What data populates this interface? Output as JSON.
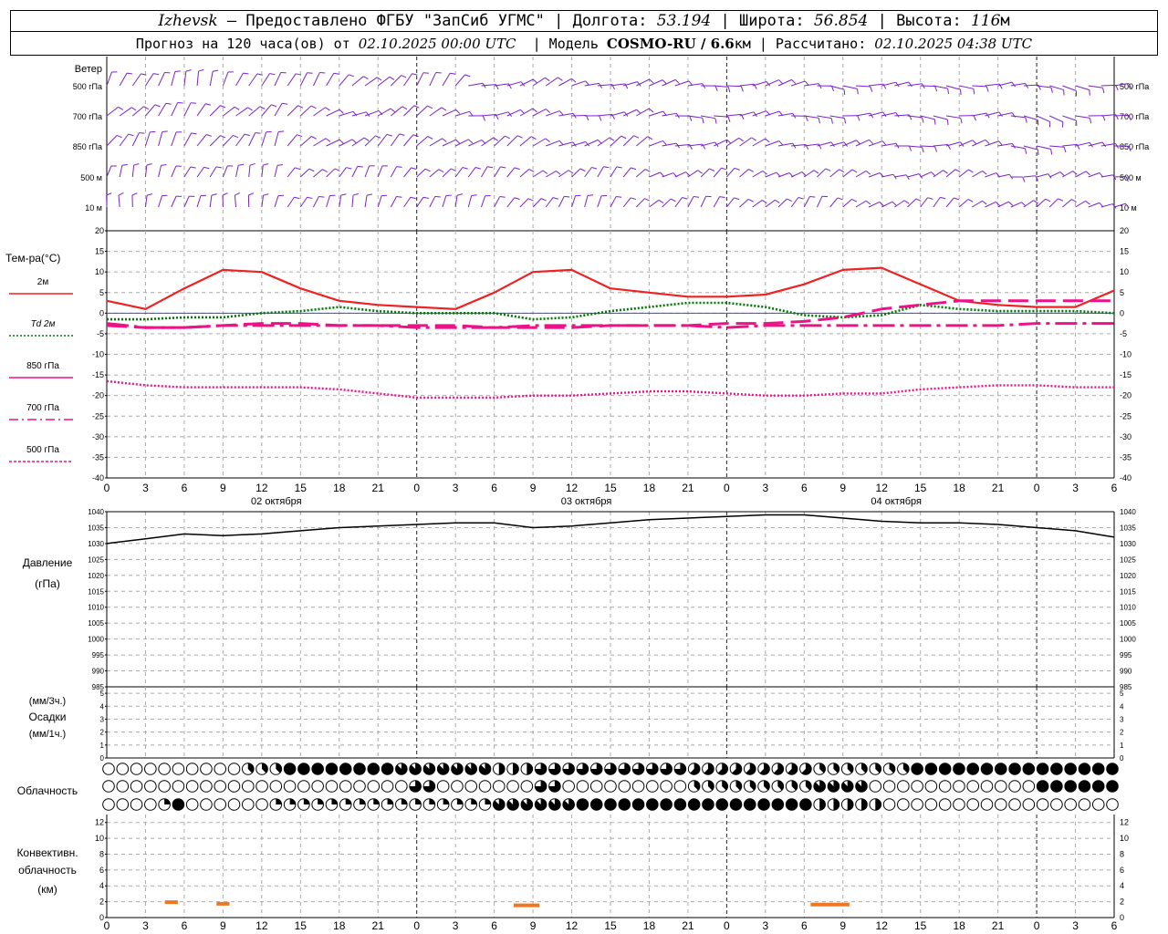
{
  "header": {
    "city": "Izhevsk",
    "provider": "– Предоставлено ФГБУ \"ЗапСиб УГМС\"",
    "lon_label": "Долгота:",
    "lon_value": "53.194",
    "lat_label": "Широта:",
    "lat_value": "56.854",
    "alt_label": "Высота:",
    "alt_value": "116",
    "alt_unit": "м",
    "forecast_label": "Прогноз на 120 часа(ов) от",
    "forecast_start": "02.10.2025 00:00 UTC",
    "model_label": "Модель",
    "model_name": "COSMO-RU / 6.6",
    "model_unit": "км",
    "computed_label": "Рассчитано:",
    "computed_value": "02.10.2025 04:38 UTC"
  },
  "colors": {
    "t2m": "#ee2222",
    "td2m": "#007700",
    "t850": "#ee1188",
    "t700": "#ee1188",
    "t500": "#ee1188",
    "barb": "#7a22cc",
    "pressure": "#000000",
    "convective": "#ee7722",
    "grid": "#aaaaaa"
  },
  "wind_panel": {
    "title": "Ветер",
    "levels": [
      "500 гПа",
      "700 гПа",
      "850 гПа",
      "500 м",
      "10 м"
    ]
  },
  "temp_panel": {
    "title": "Тем-ра(°С)",
    "legend": [
      "2м",
      "Td  2м",
      "850 гПа",
      "700 гПа",
      "500 гПа"
    ],
    "y_ticks": [
      "20",
      "15",
      "10",
      "5",
      "0",
      "-5",
      "-10",
      "-15",
      "-20",
      "-25",
      "-30",
      "-35",
      "-40"
    ]
  },
  "pressure_panel": {
    "title": "Давление",
    "unit": "(гПа)",
    "y_ticks": [
      "1040",
      "1035",
      "1030",
      "1025",
      "1020",
      "1015",
      "1010",
      "1005",
      "1000",
      "995",
      "990",
      "985"
    ]
  },
  "precip_panel": {
    "unit_top": "(мм/3ч.)",
    "title": "Осадки",
    "unit_bottom": "(мм/1ч.)",
    "y_ticks": [
      "5",
      "4",
      "3",
      "2",
      "1",
      "0"
    ]
  },
  "cloud_panel": {
    "title": "Облачность"
  },
  "conv_panel": {
    "title": "Конвективн.",
    "title2": "облачность",
    "unit": "(км)",
    "y_ticks": [
      "12",
      "10",
      "8",
      "6",
      "4",
      "2",
      "0"
    ]
  },
  "x_axis": {
    "hour_labels": [
      "0",
      "3",
      "6",
      "9",
      "12",
      "15",
      "18",
      "21",
      "0",
      "3",
      "6",
      "9",
      "12",
      "15",
      "18",
      "21",
      "0",
      "3",
      "6",
      "9",
      "12",
      "15",
      "18",
      "21",
      "0",
      "3",
      "6"
    ],
    "dates": [
      "02 октября",
      "03 октября",
      "04 октября"
    ]
  },
  "chart_data": {
    "type": "line",
    "x_hours": [
      0,
      3,
      6,
      9,
      12,
      15,
      18,
      21,
      24,
      27,
      30,
      33,
      36,
      39,
      42,
      45,
      48,
      51,
      54,
      57,
      60,
      63,
      66,
      69,
      72,
      75,
      78
    ],
    "x_unit": "hours from 02.10.2025 00:00 UTC",
    "series": [
      {
        "name": "2м",
        "values": [
          3,
          1,
          6,
          10.5,
          10,
          6,
          3,
          2,
          1.5,
          1,
          5,
          10,
          10.5,
          6,
          5,
          4,
          4,
          4.5,
          7,
          10.5,
          11,
          7,
          3,
          2,
          1.5,
          1.5,
          5.5
        ]
      },
      {
        "name": "Td  2м",
        "values": [
          -1.5,
          -1.5,
          -1,
          -1,
          0,
          0.5,
          1.5,
          0.5,
          0,
          0,
          0,
          -1.5,
          -1,
          0.5,
          1.5,
          2.5,
          2.5,
          1.5,
          -0.5,
          -1,
          -0.5,
          2,
          1,
          0.5,
          0.5,
          0.5,
          0
        ]
      },
      {
        "name": "850 гПа",
        "values": [
          -3,
          -3.5,
          -3.5,
          -3,
          -2.5,
          -2.5,
          -3,
          -3,
          -3,
          -3,
          -3.5,
          -3.5,
          -3.5,
          -3,
          -3,
          -3,
          -2.5,
          -2.5,
          -2,
          -1,
          1,
          2,
          3,
          3,
          3,
          3,
          3
        ]
      },
      {
        "name": "700 гПа",
        "values": [
          -2.5,
          -3.5,
          -3.5,
          -3,
          -3,
          -3,
          -3,
          -3,
          -3.5,
          -3.5,
          -3.5,
          -3,
          -3,
          -3,
          -3,
          -3,
          -3.5,
          -3,
          -3,
          -3,
          -3,
          -3,
          -3,
          -3,
          -2.5,
          -2.5,
          -2.5
        ]
      },
      {
        "name": "500 гПа",
        "values": [
          -16.5,
          -17.5,
          -18,
          -18,
          -18,
          -18,
          -18.5,
          -19.5,
          -20.5,
          -20.5,
          -20.5,
          -20,
          -20,
          -19.5,
          -19,
          -19,
          -19.5,
          -20,
          -20,
          -19.5,
          -19.5,
          -18.5,
          -18,
          -17.5,
          -17.5,
          -18,
          -18
        ]
      }
    ],
    "pressure": {
      "values": [
        1030,
        1031.5,
        1033,
        1032.5,
        1033,
        1034,
        1035,
        1035.5,
        1036,
        1036.5,
        1036.5,
        1035,
        1035.5,
        1036.5,
        1037.5,
        1038,
        1038.5,
        1039,
        1039,
        1038,
        1037,
        1036.5,
        1036.5,
        1036,
        1035,
        1034,
        1032
      ]
    },
    "precipitation": {
      "values": [
        0,
        0,
        0,
        0,
        0,
        0,
        0,
        0,
        0,
        0,
        0,
        0,
        0,
        0,
        0,
        0,
        0,
        0,
        0,
        0,
        0,
        0,
        0,
        0,
        0,
        0,
        0
      ]
    },
    "convective_cloud": [
      {
        "from_hour": 4.5,
        "to_hour": 5.5,
        "km": 2
      },
      {
        "from_hour": 8.5,
        "to_hour": 9.5,
        "km": 1.8
      },
      {
        "from_hour": 31.5,
        "to_hour": 33.5,
        "km": 1.6
      },
      {
        "from_hour": 54.5,
        "to_hour": 57.5,
        "km": 1.7
      }
    ],
    "ylim_temp": [
      -40,
      20
    ],
    "ylim_pressure": [
      985,
      1040
    ],
    "ylim_precip": [
      0,
      5
    ],
    "ylim_convective": [
      0,
      13
    ],
    "grid": true
  }
}
